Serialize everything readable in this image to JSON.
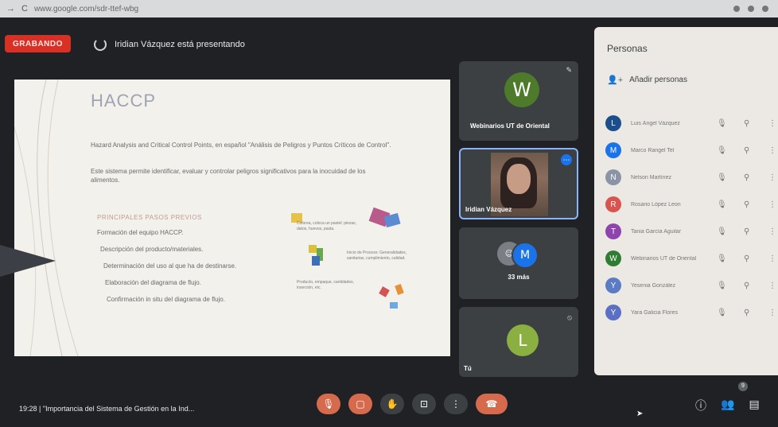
{
  "browser": {
    "nav_icons": [
      "back-arrow",
      "refresh"
    ],
    "url": "www.google.com/sdr-ttef-wbg"
  },
  "meeting": {
    "recording_label": "GRABANDO",
    "presenting_text": "Iridian Vázquez está presentando"
  },
  "slide": {
    "title": "HACCP",
    "definition": "Hazard Analysis and Critical Control Points, en español \"Análisis de Peligros y Puntos Críticos de Control\".",
    "definition2": "Este sistema permite identificar, evaluar y controlar peligros significativos para la inocuidad de los alimentos.",
    "steps_title": "PRINCIPALES PASOS PREVIOS",
    "steps": [
      "Formación del equipo HACCP.",
      "Descripción del producto/materiales.",
      "Determinación del uso al que ha de destinarse.",
      "Elaboración del diagrama de flujo.",
      "Confirmación in situ del diagrama de flujo."
    ],
    "diagram_labels": [
      "Colorea, coloca un pastel: piezas, datos, huevos, pasta.",
      "Inicio de Proceso: Generalidades, sanitarias, cumplimiento, calidad.",
      "Producto, empaque, cantidades, inserción, etc."
    ]
  },
  "tiles": {
    "w": {
      "initial": "W",
      "name": "Webinarios UT de Oriental"
    },
    "iridian": {
      "name": "Iridian Vázquez"
    },
    "more": {
      "initial": "M",
      "label": "33 más"
    },
    "self": {
      "initial": "L",
      "name": "Tú"
    }
  },
  "people_panel": {
    "title": "Personas",
    "add_label": "Añadir personas",
    "participants": [
      {
        "initial": "L",
        "name": "Luis Ángel Vázquez",
        "color": "#1a4e8c"
      },
      {
        "initial": "M",
        "name": "Marco Rangel Tel",
        "color": "#1a73e8"
      },
      {
        "initial": "N",
        "name": "Nelson Martínez",
        "color": "#8a94a6"
      },
      {
        "initial": "R",
        "name": "Rosario López Leon",
        "color": "#d9534f"
      },
      {
        "initial": "T",
        "name": "Tania García Aguilar",
        "color": "#8e44ad"
      },
      {
        "initial": "W",
        "name": "Webinarios UT de Oriental",
        "color": "#2e7d32"
      },
      {
        "initial": "Y",
        "name": "Yesenia González",
        "color": "#5b7bc4"
      },
      {
        "initial": "Y",
        "name": "Yara Galicia Flores",
        "color": "#5b6fc4"
      }
    ]
  },
  "bottom": {
    "time": "19:28",
    "separator": "|",
    "meeting_title": "\"Importancia del Sistema de Gestión en la Ind...",
    "badge_count": "9"
  },
  "colors": {
    "record_red": "#d93025",
    "control_red": "#d56a4d",
    "highlight_blue": "#8ab4f8"
  }
}
